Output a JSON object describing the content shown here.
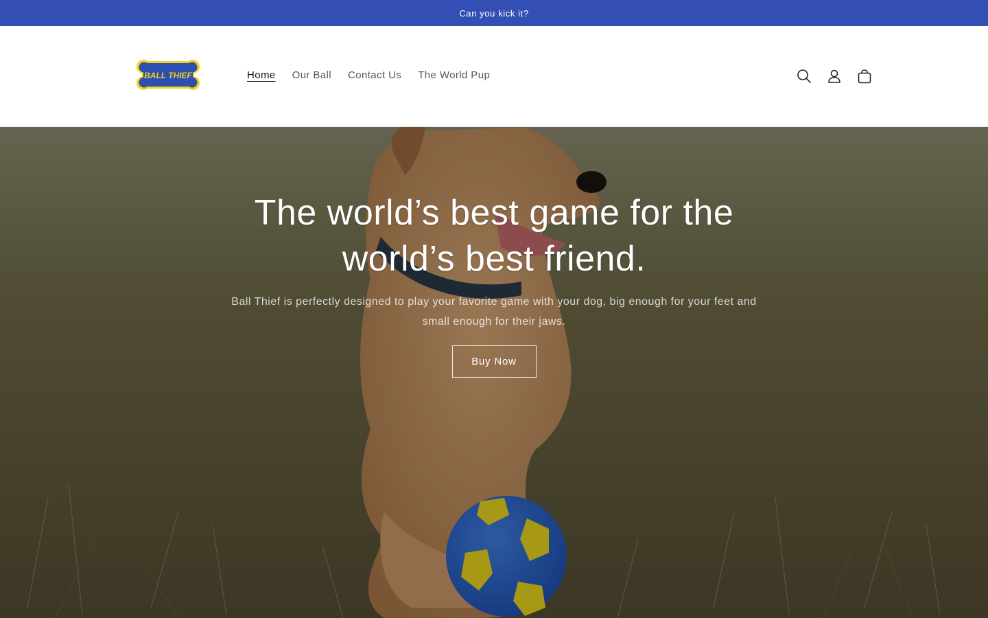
{
  "announcement": {
    "text": "Can you kick it?"
  },
  "brand": {
    "logo_text": "BALL THIEF",
    "colors": {
      "accent": "#334fb4",
      "logo_blue": "#2d4fb0",
      "logo_yellow": "#f2d21b"
    }
  },
  "nav": {
    "items": [
      {
        "label": "Home",
        "active": true
      },
      {
        "label": "Our Ball",
        "active": false
      },
      {
        "label": "Contact Us",
        "active": false
      },
      {
        "label": "The World Pup",
        "active": false
      }
    ]
  },
  "header_icons": [
    "search-icon",
    "account-icon",
    "cart-icon"
  ],
  "hero": {
    "title_line1": "The world’s best game for the",
    "title_line2": "world’s best friend.",
    "subtitle": "Ball Thief is perfectly designed to play your favorite game with your dog, big enough for your feet and small enough for their jaws.",
    "button_label": "Buy Now"
  }
}
